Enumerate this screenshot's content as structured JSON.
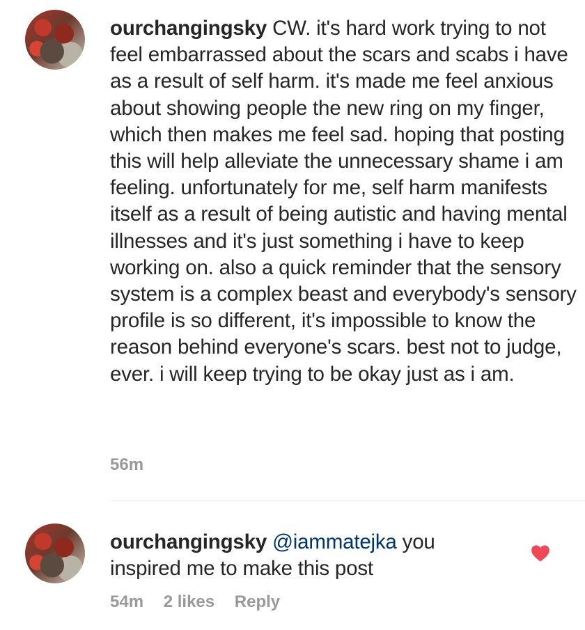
{
  "comments": [
    {
      "username": "ourchangingsky",
      "mention": "",
      "text": "CW. it's hard work trying to not feel embarrassed about the scars and scabs i have as a result of self harm. it's made me feel anxious about showing people the new ring on my finger, which then makes me feel sad. hoping that posting this will help alleviate the unnecessary shame i am feeling. unfortunately for me, self harm manifests itself as a result of being autistic and having mental illnesses and it's just something i have to keep working on. also a quick reminder that the sensory system is a complex beast and everybody's sensory profile is so different, it's impossible to know the reason behind everyone's scars. best not to judge, ever. i will keep trying to be okay just as i am.",
      "time": "56m"
    },
    {
      "username": "ourchangingsky",
      "mention": "@iammatejka",
      "text": " you inspired me to make this post",
      "time": "54m",
      "likes": "2 likes",
      "reply_label": "Reply",
      "liked": true
    }
  ],
  "colors": {
    "heart": "#ed4956",
    "meta": "#999999",
    "mention": "#003569"
  }
}
